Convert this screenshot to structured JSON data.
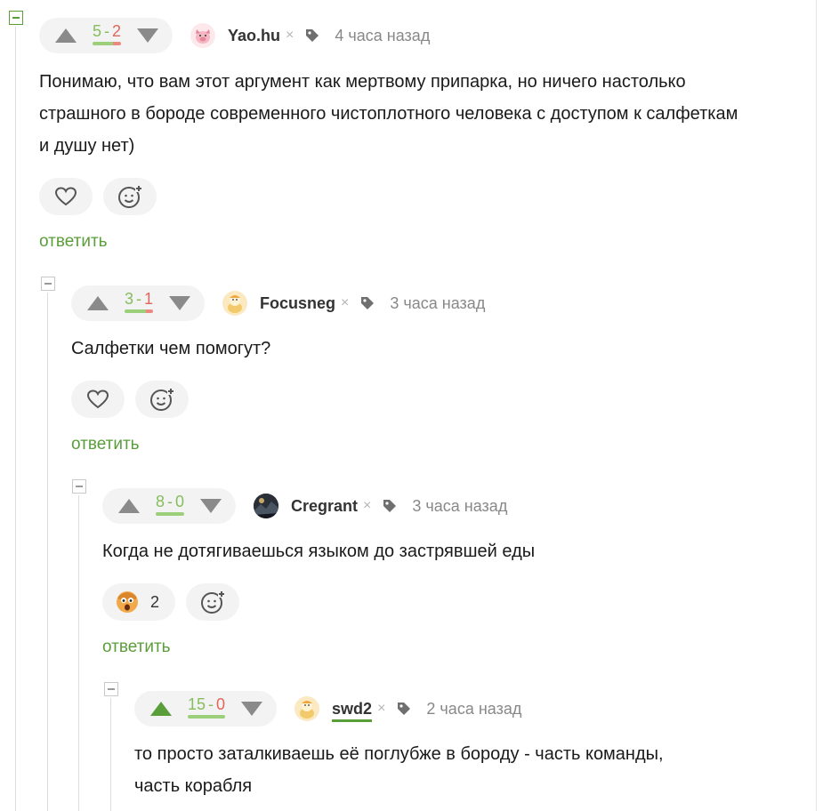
{
  "comments": [
    {
      "votes": {
        "plus": "5",
        "minus": "2",
        "sep": "-",
        "plus_frac": 0.71
      },
      "avatar_icon": "pig-avatar",
      "author": "Yao.hu",
      "time": "4 часа назад",
      "text": "Понимаю, что вам этот аргумент как мертвому припарка, но ничего настолько страшного в бороде современного чистоплотного человека с доступом к салфеткам и душу нет)",
      "reply": "ответить"
    },
    {
      "votes": {
        "plus": "3",
        "minus": "1",
        "sep": "-",
        "plus_frac": 0.75
      },
      "avatar_icon": "snowman-avatar",
      "author": "Focusneg",
      "time": "3 часа назад",
      "text": "Салфетки чем помогут?",
      "reply": "ответить"
    },
    {
      "votes": {
        "plus": "8",
        "minus": "0",
        "sep": "-",
        "plus_frac": 1.0
      },
      "avatar_icon": "photo-avatar",
      "author": "Cregrant",
      "time": "3 часа назад",
      "text": "Когда не дотягиваешься языком до застрявшей еды",
      "reaction_count": "2",
      "reply": "ответить"
    },
    {
      "votes": {
        "plus": "15",
        "minus": "0",
        "sep": "-",
        "plus_frac": 1.0
      },
      "avatar_icon": "snowman-avatar",
      "author": "swd2",
      "time": "2 часа назад",
      "text_line1": "то просто заталкиваешь её поглубже в бороду - часть команды,",
      "text_line2": "часть корабля"
    }
  ],
  "colors": {
    "accent": "#5a9e3a",
    "plus": "#86bd5c",
    "minus": "#e0665b",
    "muted": "#888888"
  }
}
